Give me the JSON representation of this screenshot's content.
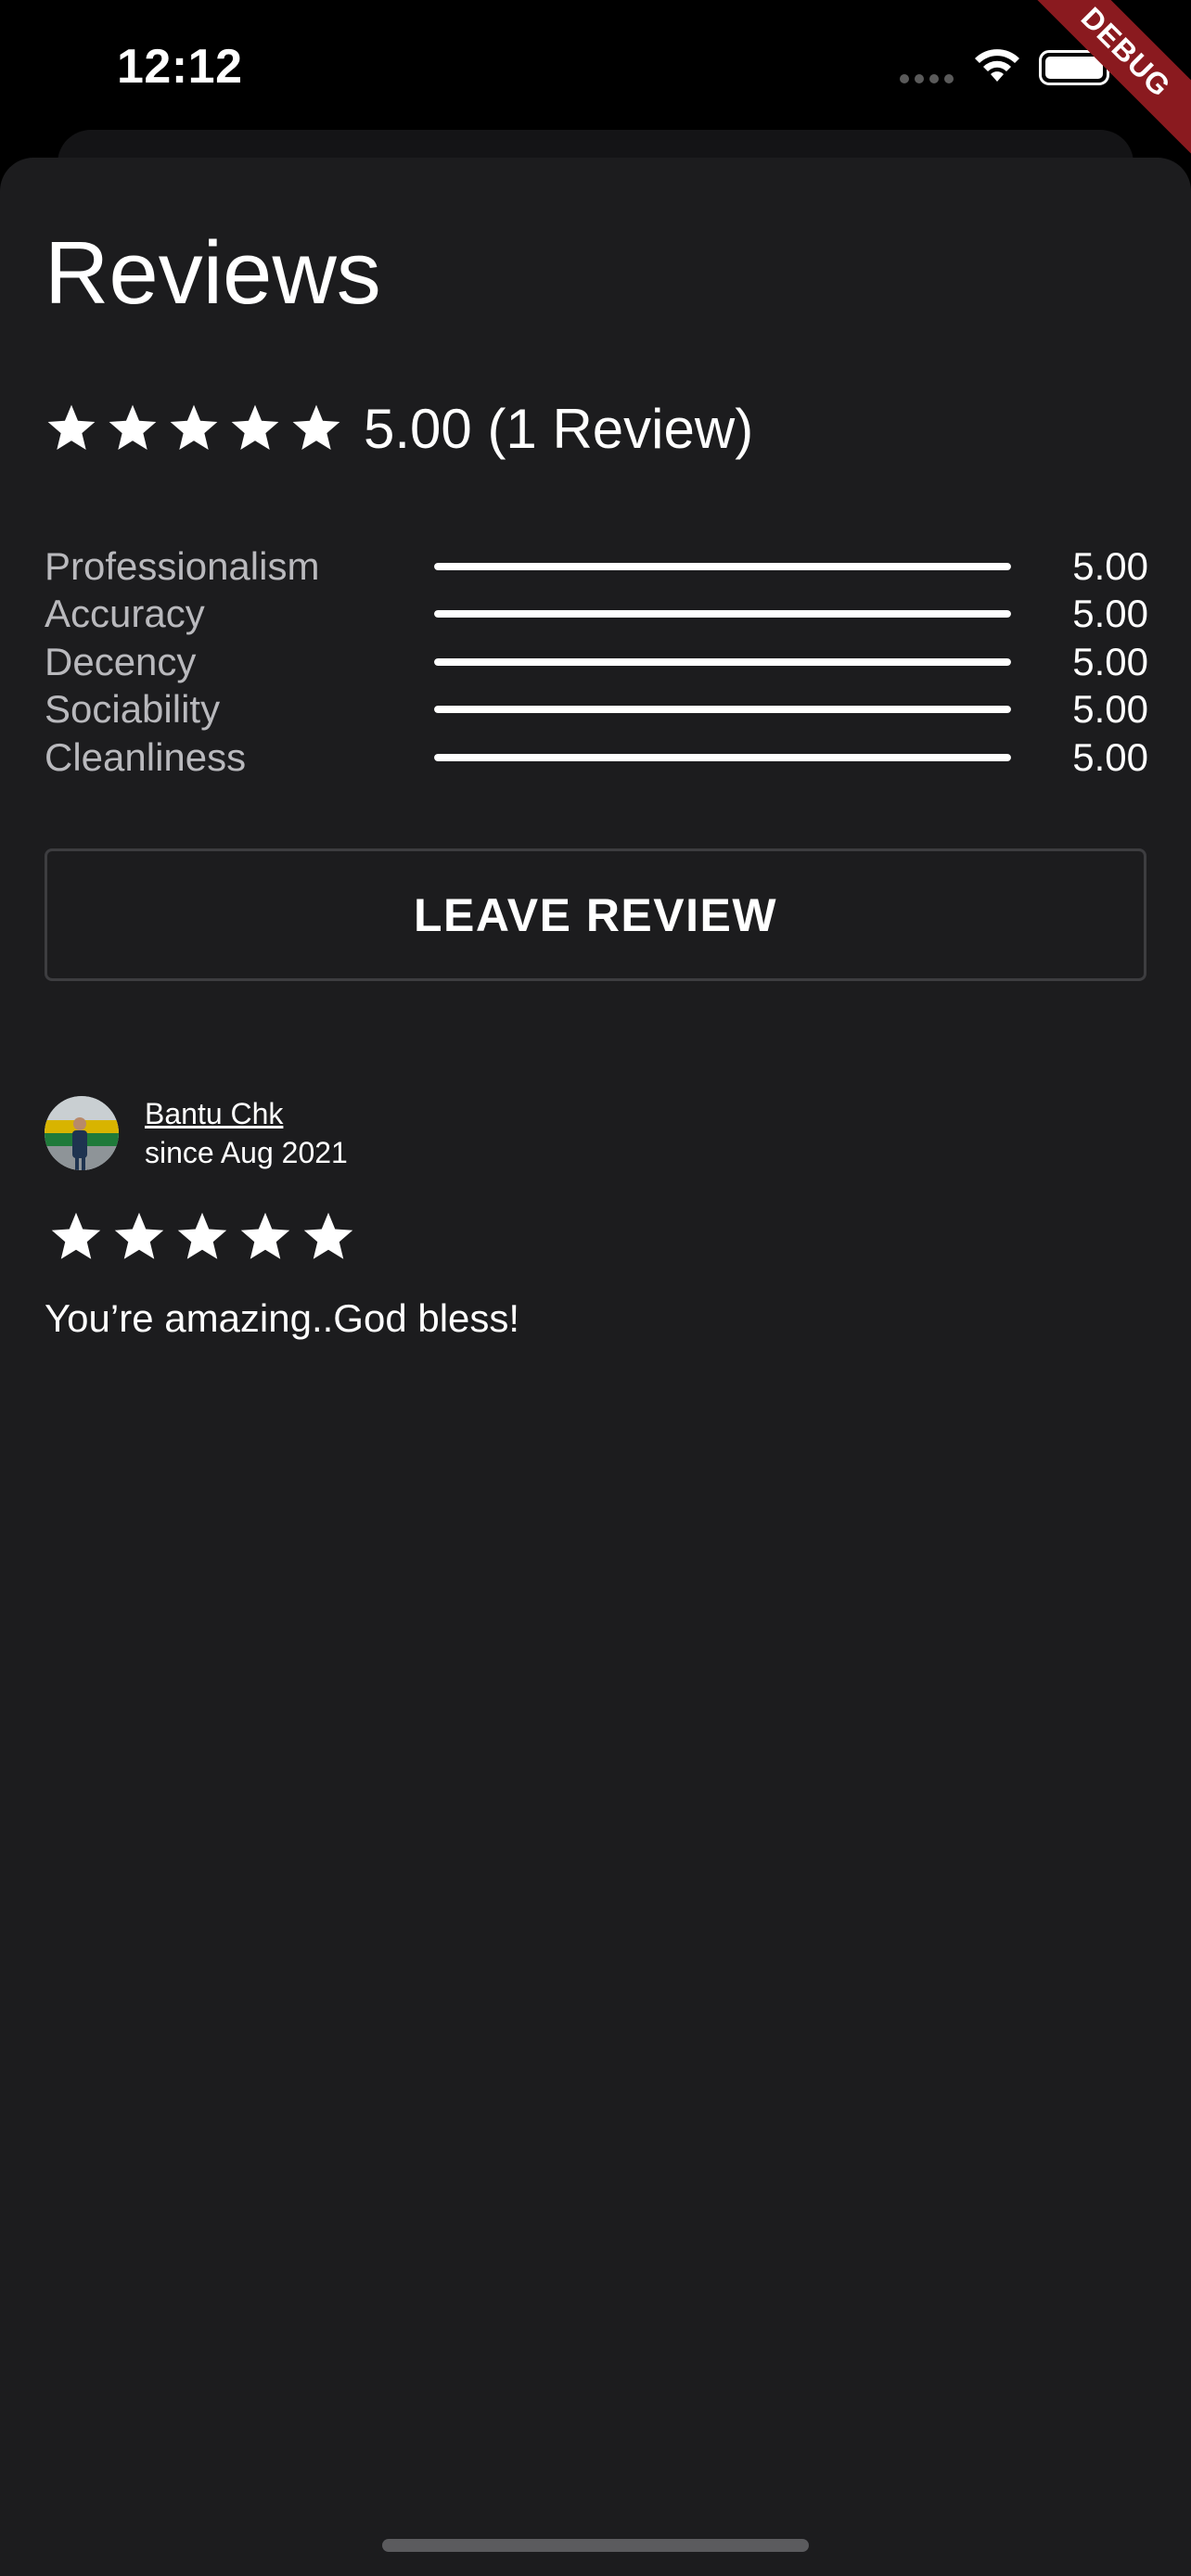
{
  "status_bar": {
    "time": "12:12",
    "debug_label": "DEBUG"
  },
  "page": {
    "title": "Reviews"
  },
  "summary": {
    "stars": 5,
    "text": "5.00 (1 Review)"
  },
  "criteria": [
    {
      "label": "Professionalism",
      "value": "5.00",
      "fraction": 1.0
    },
    {
      "label": "Accuracy",
      "value": "5.00",
      "fraction": 1.0
    },
    {
      "label": "Decency",
      "value": "5.00",
      "fraction": 1.0
    },
    {
      "label": "Sociability",
      "value": "5.00",
      "fraction": 1.0
    },
    {
      "label": "Cleanliness",
      "value": "5.00",
      "fraction": 1.0
    }
  ],
  "actions": {
    "leave_review_label": "LEAVE REVIEW"
  },
  "reviews": [
    {
      "name": "Bantu Chk",
      "since": "since Aug 2021",
      "stars": 5,
      "text": "You’re amazing..God bless!"
    }
  ],
  "colors": {
    "background": "#000000",
    "sheet": "#1c1c1e",
    "label_gray": "#b9b9bd",
    "debug_banner": "#8a1a1f",
    "button_border": "#3d3d40"
  },
  "icons": {
    "star": "star-icon",
    "wifi": "wifi-icon",
    "battery": "battery-icon"
  }
}
